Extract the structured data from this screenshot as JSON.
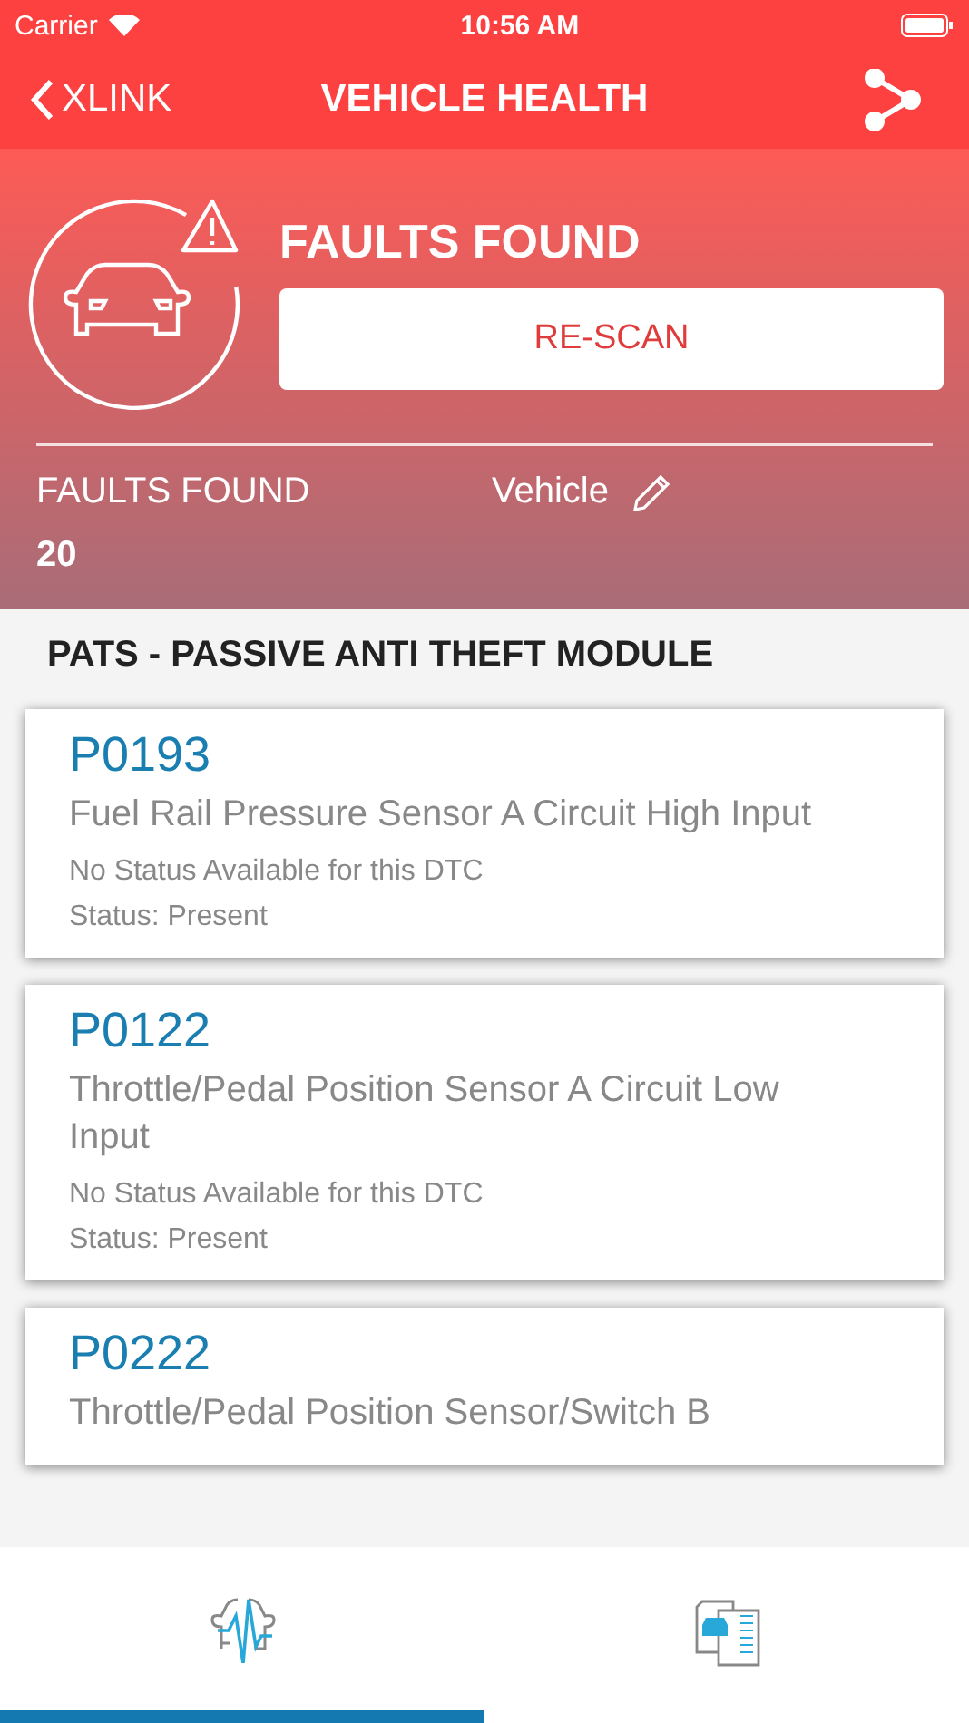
{
  "status_bar": {
    "carrier": "Carrier",
    "time": "10:56 AM"
  },
  "nav": {
    "back": "XLINK",
    "title": "VEHICLE HEALTH"
  },
  "summary": {
    "heading": "FAULTS FOUND",
    "button": "RE-SCAN",
    "stat_label": "FAULTS FOUND",
    "stat_value": "20",
    "vehicle_label": "Vehicle"
  },
  "section_title": "PATS - PASSIVE ANTI THEFT MODULE",
  "faults": [
    {
      "code": "P0193",
      "description": "Fuel Rail Pressure Sensor A Circuit High Input",
      "note": "No Status Available for this DTC",
      "status": "Status: Present"
    },
    {
      "code": "P0122",
      "description": "Throttle/Pedal Position Sensor A Circuit Low Input",
      "note": "No Status Available for this DTC",
      "status": "Status: Present"
    },
    {
      "code": "P0222",
      "description": "Throttle/Pedal Position Sensor/Switch B"
    }
  ],
  "tabs": [
    {
      "kind": "health",
      "selected": true
    },
    {
      "kind": "report",
      "selected": false
    }
  ]
}
